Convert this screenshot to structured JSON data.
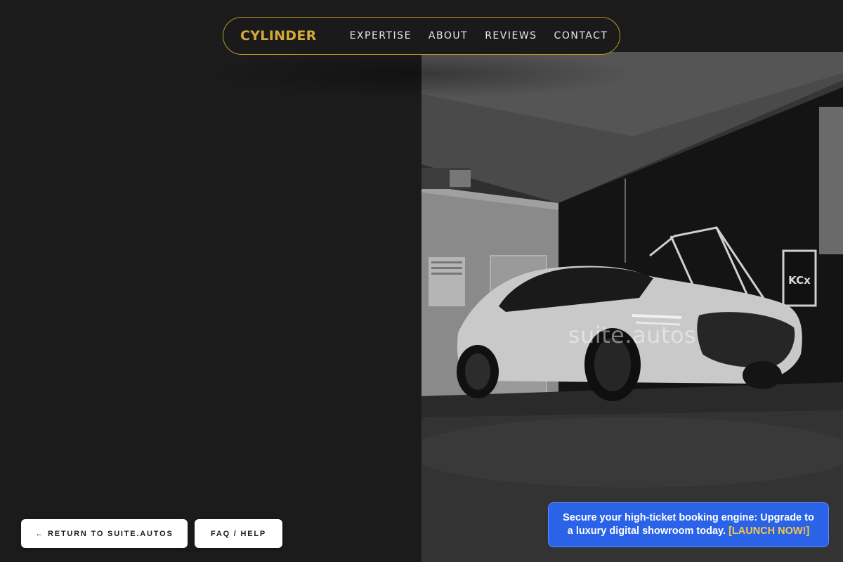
{
  "brand": {
    "name": "CYLINDER"
  },
  "nav": {
    "links": [
      "EXPERTISE",
      "ABOUT",
      "REVIEWS",
      "CONTACT"
    ]
  },
  "hero": {
    "watermark": "suite.autos",
    "sign_text": "KCx"
  },
  "buttons": {
    "return_label": "← RETURN TO SUITE.AUTOS",
    "faq_label": "FAQ / HELP"
  },
  "promo": {
    "text": "Secure your high-ticket booking engine: Upgrade to a luxury digital showroom today.",
    "cta": "[LAUNCH NOW!]"
  },
  "colors": {
    "background": "#1b1b1b",
    "accent_gold": "#d4a93a",
    "promo_blue": "#2b63e8",
    "cta_yellow": "#f5c842"
  },
  "icons": {
    "return_arrow": "arrow-left-icon"
  }
}
